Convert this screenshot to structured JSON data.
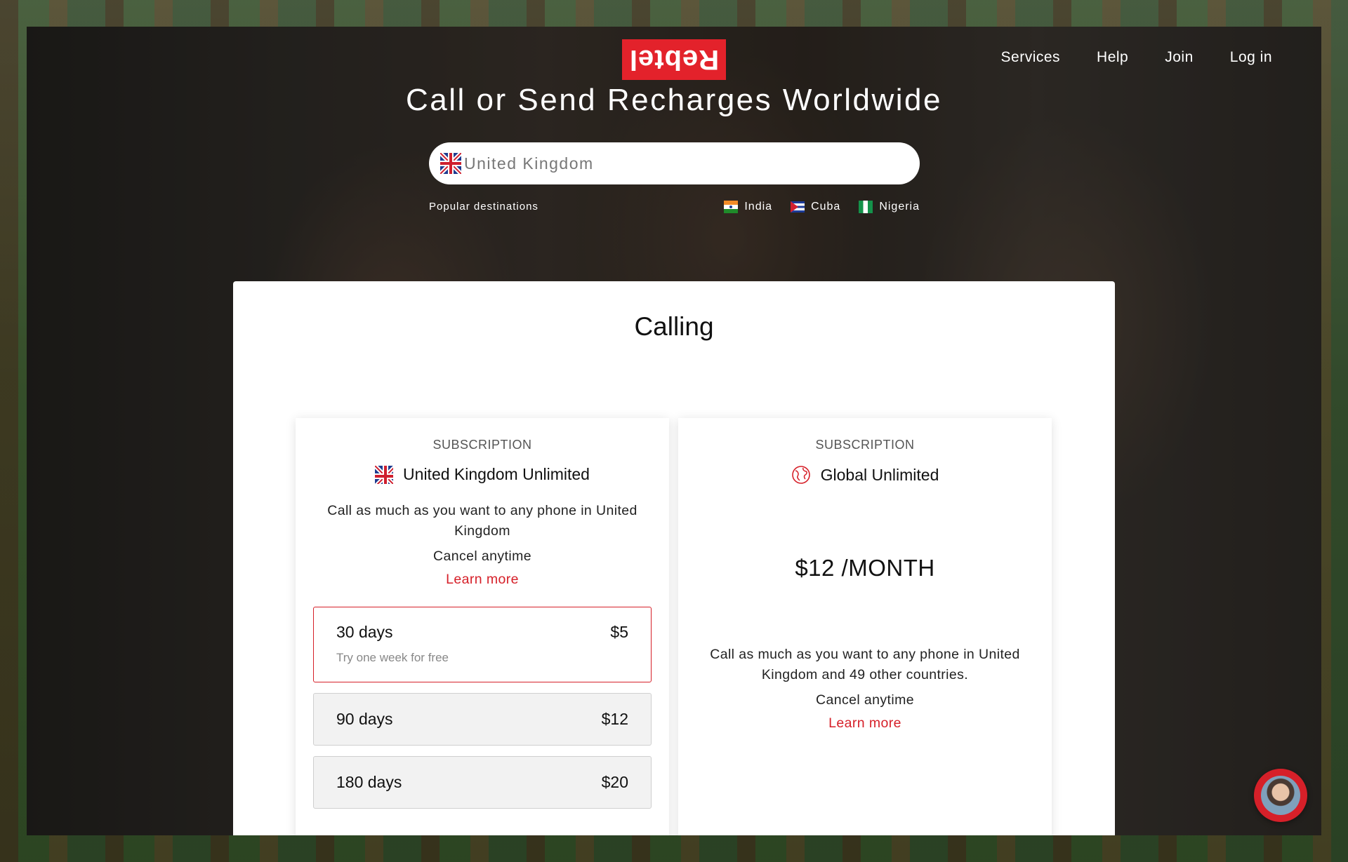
{
  "brand": {
    "logo_text": "Rebtel",
    "accent": "#d62029"
  },
  "nav": {
    "items": [
      "Services",
      "Help",
      "Join",
      "Log in"
    ]
  },
  "hero": {
    "title": "Call or Send Recharges Worldwide",
    "search_placeholder": "United Kingdom",
    "search_icon": "uk-flag-icon",
    "popular_label": "Popular destinations",
    "destinations": [
      {
        "label": "India",
        "icon": "india-flag-icon"
      },
      {
        "label": "Cuba",
        "icon": "cuba-flag-icon"
      },
      {
        "label": "Nigeria",
        "icon": "nigeria-flag-icon"
      }
    ]
  },
  "calling": {
    "heading": "Calling",
    "plans": [
      {
        "kicker": "SUBSCRIPTION",
        "title": "United Kingdom Unlimited",
        "icon": "uk-flag-icon",
        "description": "Call as much as you want to any phone in United Kingdom",
        "cancel": "Cancel anytime",
        "learn_more": "Learn more",
        "options": [
          {
            "duration": "30 days",
            "price": "$5",
            "note": "Try one week for free",
            "selected": true
          },
          {
            "duration": "90 days",
            "price": "$12"
          },
          {
            "duration": "180 days",
            "price": "$20"
          }
        ]
      },
      {
        "kicker": "SUBSCRIPTION",
        "title": "Global Unlimited",
        "icon": "globe-icon",
        "price": "$12 /MONTH",
        "description": "Call as much as you want to any phone in United Kingdom and 49 other countries.",
        "cancel": "Cancel anytime",
        "learn_more": "Learn more"
      }
    ]
  },
  "chat": {
    "icon": "chat-avatar-icon"
  }
}
